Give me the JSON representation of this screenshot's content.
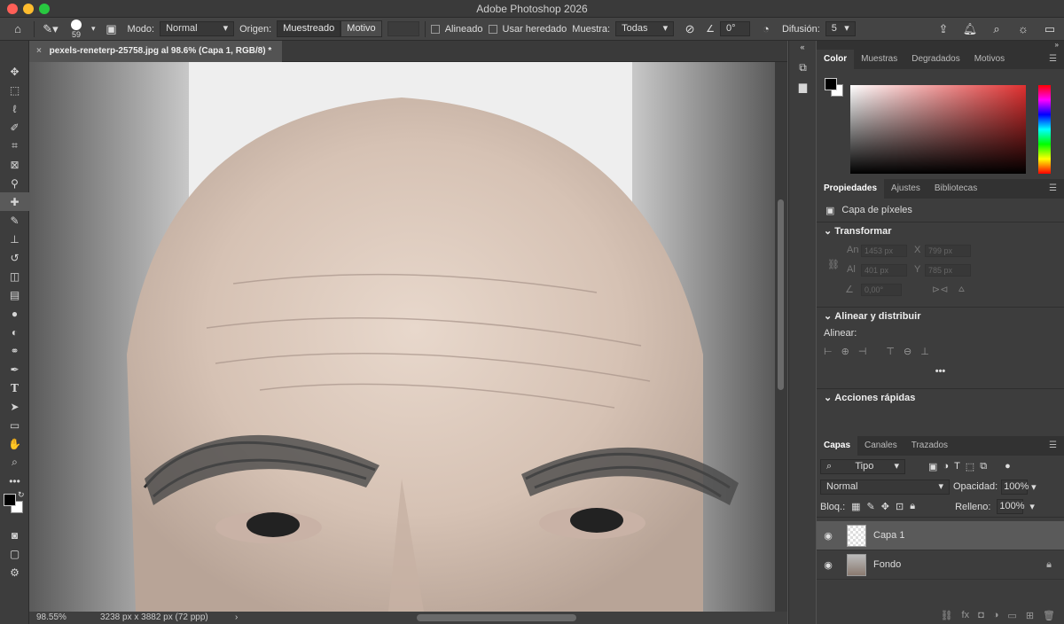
{
  "window": {
    "title": "Adobe Photoshop 2026"
  },
  "options": {
    "brush_size": "59",
    "mode_label": "Modo:",
    "mode_value": "Normal",
    "source_label": "Origen:",
    "source_sampled": "Muestreado",
    "source_pattern": "Motivo",
    "aligned_label": "Alineado",
    "use_legacy_label": "Usar heredado",
    "sample_label": "Muestra:",
    "sample_value": "Todas",
    "angle_value": "0°",
    "diffusion_label": "Difusión:",
    "diffusion_value": "5"
  },
  "document": {
    "tab_title": "pexels-reneterp-25758.jpg al 98.6% (Capa 1, RGB/8) *",
    "zoom": "98.55%",
    "size_info": "3238 px x 3882 px (72 ppp)"
  },
  "color_panel": {
    "tabs": [
      "Color",
      "Muestras",
      "Degradados",
      "Motivos"
    ]
  },
  "properties_panel": {
    "tabs": [
      "Propiedades",
      "Ajustes",
      "Bibliotecas"
    ],
    "layer_type": "Capa de píxeles",
    "transform_title": "Transformar",
    "w_label": "An",
    "w_value": "1453 px",
    "x_label": "X",
    "x_value": "799 px",
    "h_label": "Al",
    "h_value": "401 px",
    "y_label": "Y",
    "y_value": "785 px",
    "angle_value": "0,00°",
    "align_title": "Alinear y distribuir",
    "align_label": "Alinear:",
    "more": "•••",
    "quick_actions_title": "Acciones rápidas"
  },
  "layers_panel": {
    "tabs": [
      "Capas",
      "Canales",
      "Trazados"
    ],
    "filter_value": "Tipo",
    "blend_value": "Normal",
    "opacity_label": "Opacidad:",
    "opacity_value": "100%",
    "lock_label": "Bloq.:",
    "fill_label": "Relleno:",
    "fill_value": "100%",
    "layers": [
      {
        "name": "Capa 1"
      },
      {
        "name": "Fondo"
      }
    ]
  },
  "colors": {
    "foreground": "#000000",
    "background": "#ffffff",
    "accent_red": "#e03030"
  }
}
